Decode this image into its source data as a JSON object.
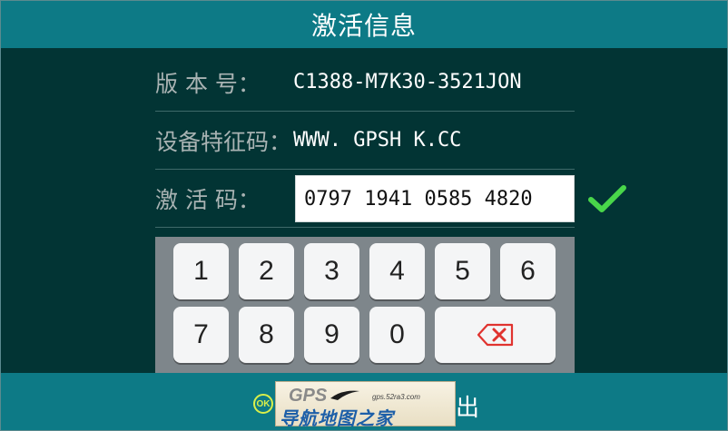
{
  "header": {
    "title": "激活信息"
  },
  "fields": {
    "version": {
      "label": "版 本 号：",
      "value": "C1388-M7K30-3521JON"
    },
    "device_code": {
      "label": "设备特征码：",
      "value": "WWW. GPSH K.CC"
    },
    "activation_code": {
      "label": "激 活 码：",
      "value": "0797 1941 0585 4820"
    }
  },
  "status_icon": "check-icon",
  "keypad": {
    "row1": [
      "1",
      "2",
      "3",
      "4",
      "5",
      "6"
    ],
    "row2": [
      "7",
      "8",
      "9",
      "0"
    ],
    "backspace_icon": "backspace-icon"
  },
  "footer": {
    "ok_icon_text": "OK",
    "exit_text": "出"
  },
  "watermark": {
    "brand": "GPS",
    "url": "gps.52ra3.com",
    "name": "导航地图之家"
  },
  "colors": {
    "header_bg": "#0d7a86",
    "body_bg": "#023434",
    "check": "#49d64a",
    "backspace": "#e0332f",
    "keypad_bg": "#7e868b"
  }
}
